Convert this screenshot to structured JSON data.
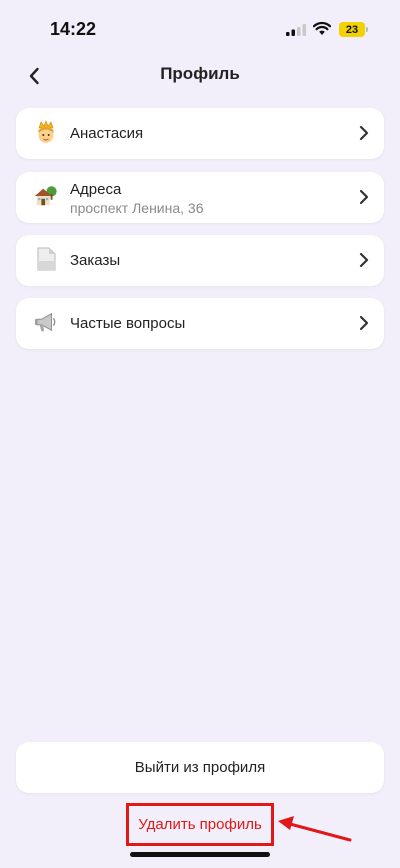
{
  "status_bar": {
    "time": "14:22",
    "battery_level": "23",
    "signal_icon": "cellular-signal-icon",
    "wifi_icon": "wifi-icon"
  },
  "header": {
    "title": "Профиль",
    "back_icon": "chevron-left-icon"
  },
  "menu": {
    "items": [
      {
        "label": "Анастасия",
        "icon": "crown-face-icon"
      },
      {
        "label": "Адреса",
        "sublabel": "проспект Ленина, 36",
        "icon": "house-icon"
      },
      {
        "label": "Заказы",
        "icon": "document-icon"
      },
      {
        "label": "Частые вопросы",
        "icon": "megaphone-icon"
      }
    ]
  },
  "footer": {
    "logout_label": "Выйти из профиля",
    "delete_label": "Удалить профиль"
  },
  "colors": {
    "background": "#f3effa",
    "card": "#ffffff",
    "annotation": "#e01818",
    "battery": "#f2d200"
  }
}
